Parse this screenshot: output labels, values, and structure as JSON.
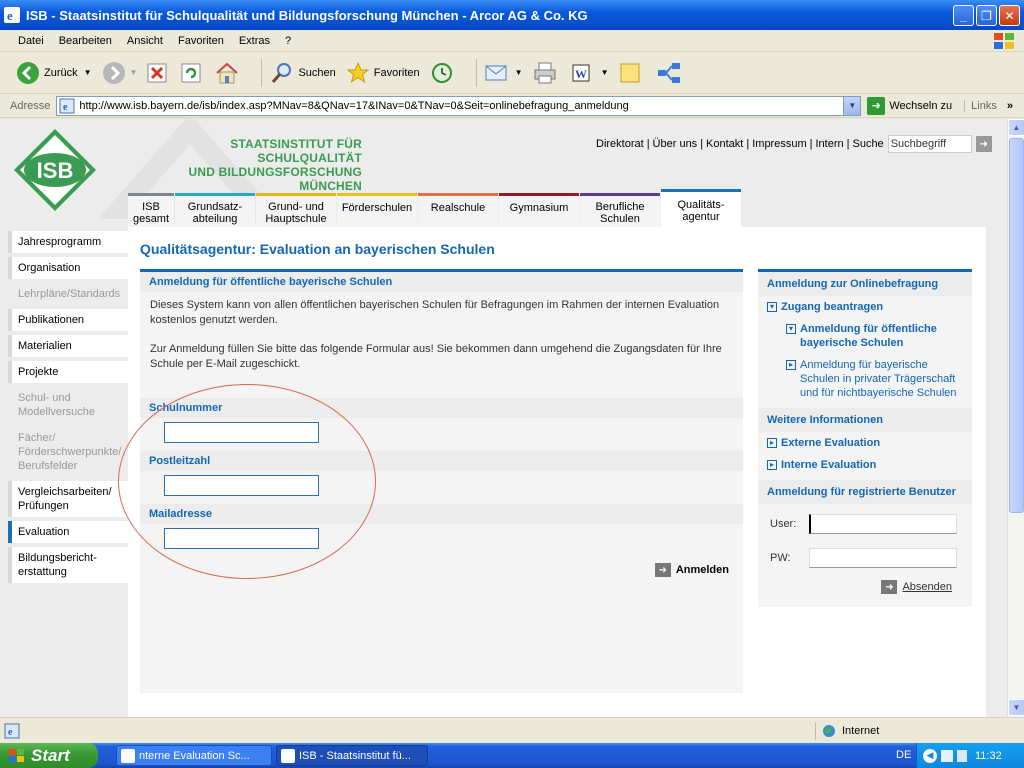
{
  "window": {
    "title": "ISB - Staatsinstitut für Schulqualität und Bildungsforschung München - Arcor AG & Co. KG"
  },
  "menu": [
    "Datei",
    "Bearbeiten",
    "Ansicht",
    "Favoriten",
    "Extras",
    "?"
  ],
  "toolbar": {
    "back": "Zurück",
    "search": "Suchen",
    "favorites": "Favoriten"
  },
  "address": {
    "label": "Adresse",
    "url": "http://www.isb.bayern.de/isb/index.asp?MNav=8&QNav=17&INav=0&TNav=0&Seit=onlinebefragung_anmeldung",
    "go": "Wechseln zu",
    "links": "Links"
  },
  "site": {
    "brand_line1": "STAATSINSTITUT FÜR SCHULQUALITÄT",
    "brand_line2": "UND BILDUNGSFORSCHUNG",
    "brand_line3": "MÜNCHEN",
    "topnav": [
      "Direktorat",
      "Über uns",
      "Kontakt",
      "Impressum",
      "Intern",
      "Suche"
    ],
    "search_placeholder": "Suchbegriff",
    "tabs": [
      {
        "line1": "ISB",
        "line2": "gesamt",
        "color": "#7a8a8c"
      },
      {
        "line1": "Grundsatz-",
        "line2": "abteilung",
        "color": "#2aa5c5"
      },
      {
        "line1": "Grund- und",
        "line2": "Hauptschule",
        "color": "#e8b418"
      },
      {
        "line1": "Förderschulen",
        "line2": "",
        "color": "#e8c020"
      },
      {
        "line1": "Realschule",
        "line2": "",
        "color": "#e46e3c"
      },
      {
        "line1": "Gymnasium",
        "line2": "",
        "color": "#8c1c2a"
      },
      {
        "line1": "Berufliche",
        "line2": "Schulen",
        "color": "#5a3c8c"
      },
      {
        "line1": "Qualitäts-",
        "line2": "agentur",
        "color": "#1f6fb5"
      }
    ],
    "leftnav": [
      {
        "label": "Jahresprogramm",
        "state": "normal"
      },
      {
        "label": "Organisation",
        "state": "normal"
      },
      {
        "label": "Lehrpläne/Standards",
        "state": "dim"
      },
      {
        "label": "Publikationen",
        "state": "normal"
      },
      {
        "label": "Materialien",
        "state": "normal"
      },
      {
        "label": "Projekte",
        "state": "normal"
      },
      {
        "label": "Schul- und Modellversuche",
        "state": "dim"
      },
      {
        "label": "Fächer/ Förderschwerpunkte/ Berufsfelder",
        "state": "dim"
      },
      {
        "label": "Vergleichsarbeiten/ Prüfungen",
        "state": "normal"
      },
      {
        "label": "Evaluation",
        "state": "active"
      },
      {
        "label": "Bildungsbericht-erstattung",
        "state": "normal"
      }
    ]
  },
  "main": {
    "page_title": "Qualitätsagentur: Evaluation an bayerischen Schulen",
    "box_title": "Anmeldung für öffentliche bayerische Schulen",
    "intro1": "Dieses System kann von allen öffentlichen bayerischen Schulen für Befragungen im Rahmen der internen Evaluation kostenlos genutzt werden.",
    "intro2": "Zur Anmeldung füllen Sie bitte das folgende Formular aus! Sie bekommen dann umgehend die Zugangsdaten für Ihre Schule per E-Mail zugeschickt.",
    "fields": [
      {
        "label": "Schulnummer",
        "value": ""
      },
      {
        "label": "Postleitzahl",
        "value": ""
      },
      {
        "label": "Mailadresse",
        "value": ""
      }
    ],
    "submit": "Anmelden"
  },
  "sidebar": {
    "head": "Anmeldung zur Onlinebefragung",
    "access": "Zugang beantragen",
    "public": "Anmeldung für öffentliche bayerische Schulen",
    "private": "Anmeldung für bayerische Schulen in privater Trägerschaft und für nichtbayerische Schulen",
    "more": "Weitere Informationen",
    "external": "Externe Evaluation",
    "internal": "Interne Evaluation",
    "registered": "Anmeldung für registrierte Benutzer",
    "user_label": "User:",
    "pw_label": "PW:",
    "send": "Absenden"
  },
  "statusbar": {
    "zone": "Internet"
  },
  "taskbar": {
    "start": "Start",
    "task1": "nterne Evaluation Sc...",
    "task2": "ISB - Staatsinstitut fü...",
    "lang": "DE",
    "time": "11:32"
  }
}
